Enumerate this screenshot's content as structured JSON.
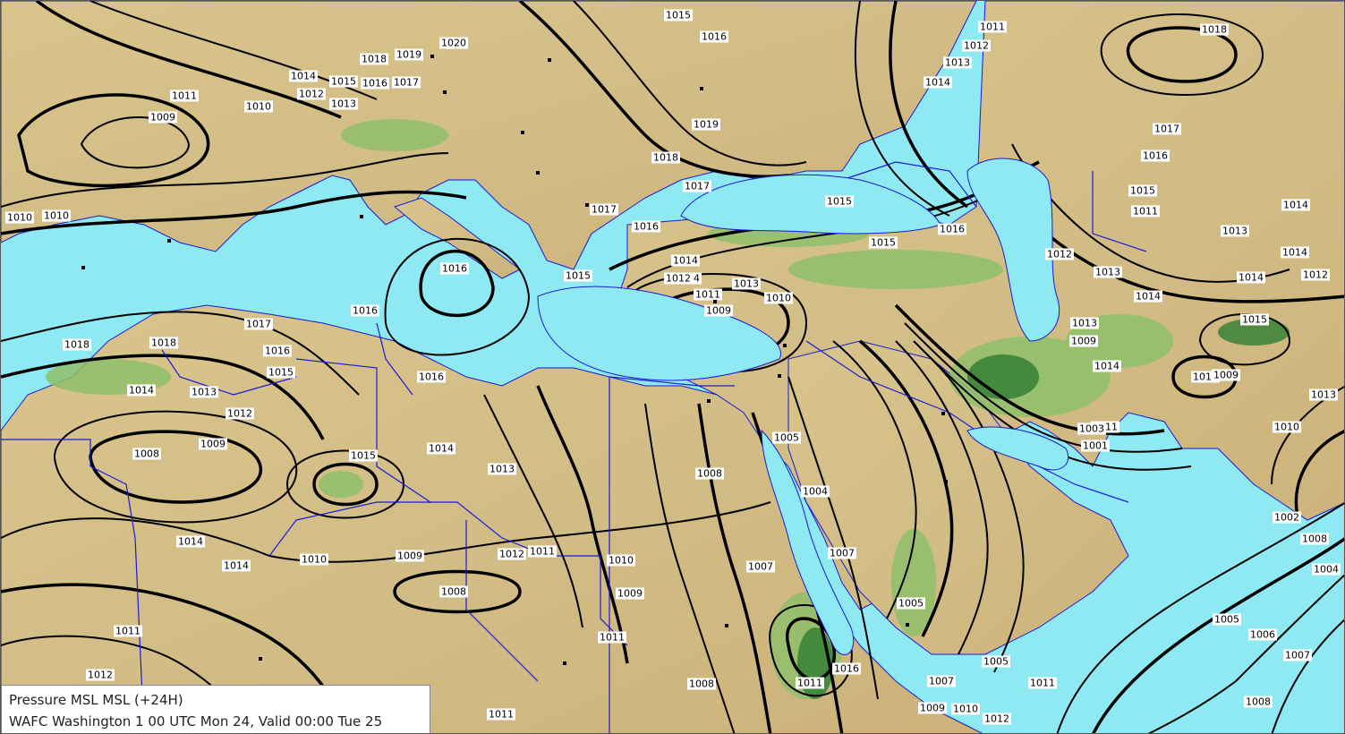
{
  "info": {
    "line1": "Pressure MSL  MSL (+24H)",
    "line2": "WAFC Washington 1 00 UTC Mon 24, Valid 00:00 Tue 25"
  },
  "colors": {
    "sea": "#8fe9f2",
    "land": "#dcc791",
    "highland": "#7fb35a",
    "mountain": "#2e7d32",
    "isobar": "#000000",
    "border": "#1a1ad6"
  },
  "isobar_labels": [
    "1015",
    "1016",
    "1011",
    "1012",
    "1018",
    "1013",
    "1020",
    "1019",
    "1018",
    "1017",
    "1016",
    "1015",
    "1014",
    "1012",
    "1013",
    "1011",
    "1010",
    "1009",
    "1014",
    "1019",
    "1018",
    "1017",
    "1017",
    "1016",
    "1015",
    "1015",
    "1016",
    "1014",
    "1014",
    "1012",
    "1013",
    "1011",
    "1010",
    "1009",
    "1015",
    "1016",
    "1016",
    "1016",
    "1017",
    "1016",
    "1015",
    "1018",
    "1018",
    "1014",
    "1013",
    "1012",
    "1009",
    "1008",
    "1015",
    "1014",
    "1013",
    "1012",
    "1011",
    "1009",
    "1010",
    "1008",
    "1009",
    "1010",
    "1007",
    "1008",
    "1005",
    "1004",
    "1007",
    "1005",
    "1005",
    "1007",
    "1011",
    "1016",
    "1011",
    "1008",
    "1009",
    "1010",
    "1012",
    "1013",
    "1014",
    "1014",
    "1011",
    "1012",
    "1013",
    "1017",
    "1016",
    "1015",
    "1014",
    "1013",
    "1012",
    "1014",
    "1015",
    "1009",
    "1014",
    "1011",
    "1012",
    "1013",
    "1010",
    "1003",
    "1001",
    "1002",
    "1008",
    "1004",
    "1005",
    "1006",
    "1007",
    "1008",
    "1009",
    "1010",
    "1011",
    "1012",
    "1014",
    "1014",
    "1011",
    "1010",
    "1011"
  ],
  "legend": {}
}
